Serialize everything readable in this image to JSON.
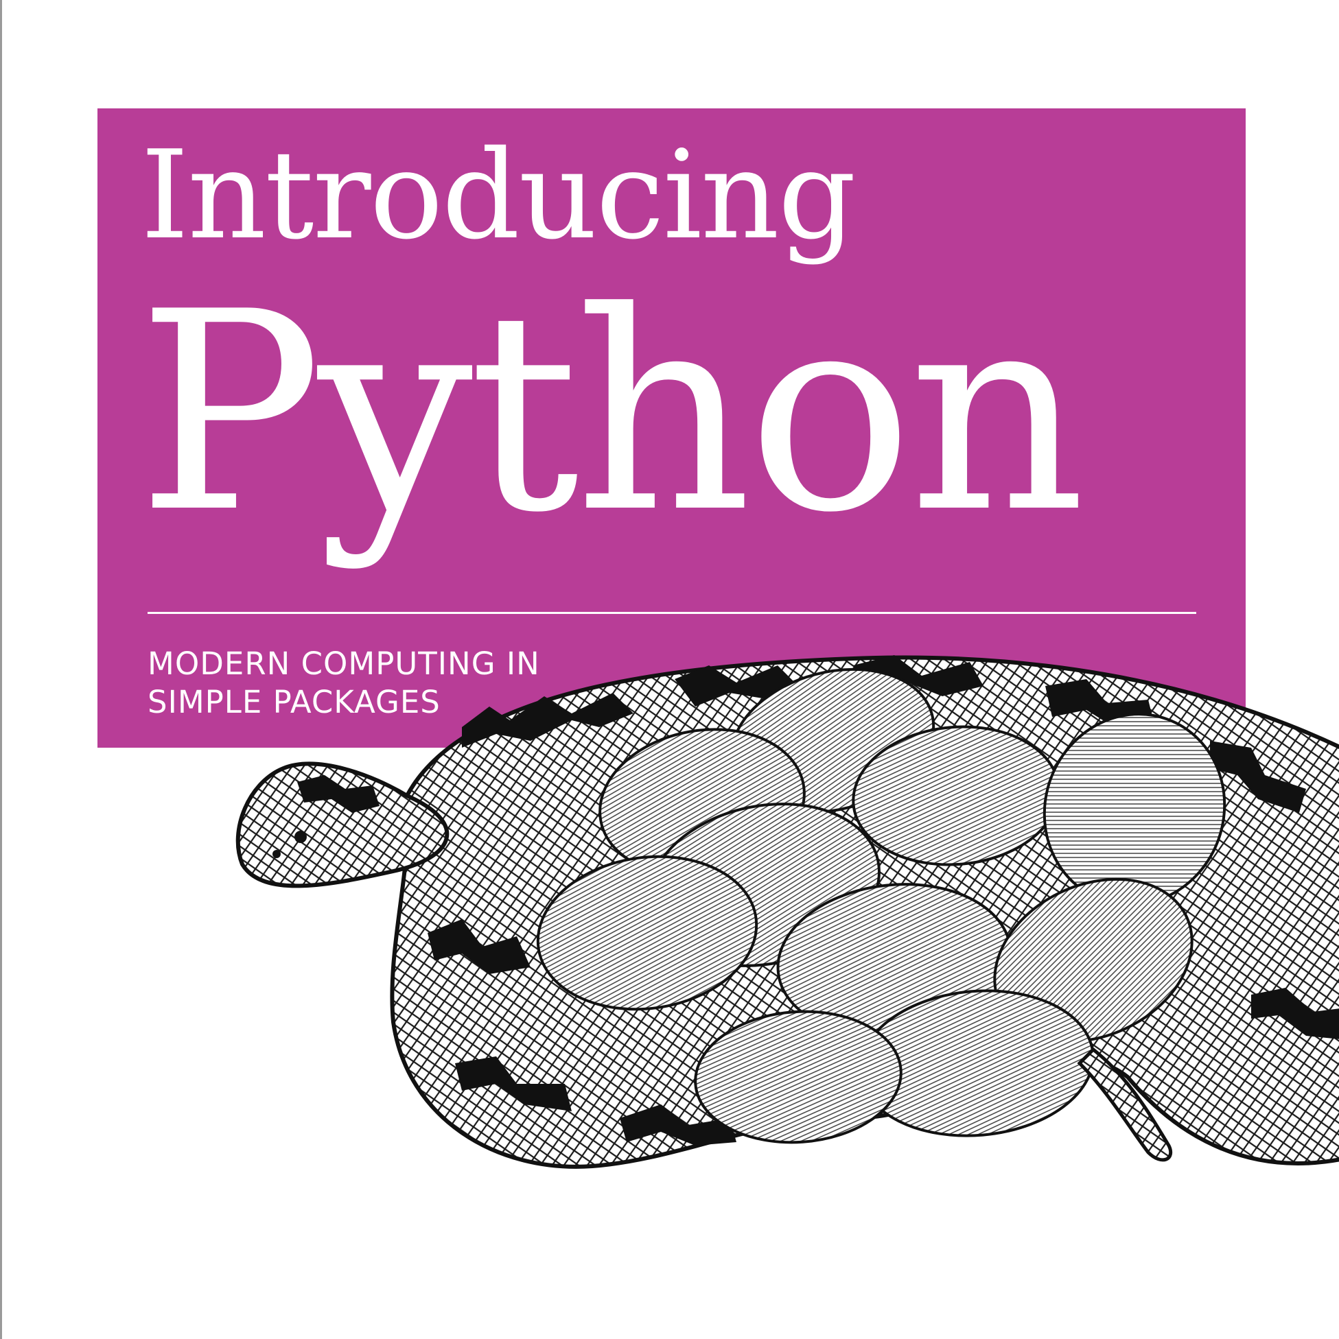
{
  "cover": {
    "title_line1": "Introducing",
    "title_line2": "Python",
    "subtitle_line1": "MODERN COMPUTING IN",
    "subtitle_line2": "SIMPLE PACKAGES",
    "illustration": "python-snake-with-eggs-engraving"
  },
  "colors": {
    "banner": "#b83d97",
    "text": "#ffffff",
    "ink": "#111111",
    "background": "#ffffff"
  }
}
